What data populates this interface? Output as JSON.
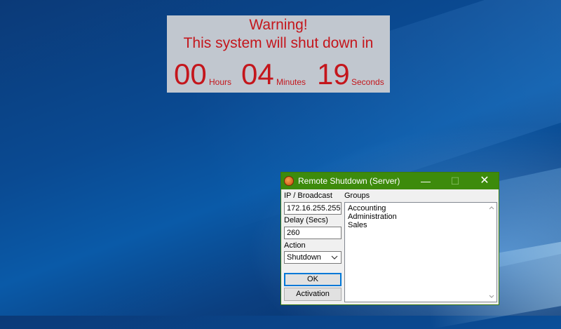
{
  "banner": {
    "line1": "Warning!",
    "line2": "This system will shut down in",
    "hours": "00",
    "hours_label": "Hours",
    "minutes": "04",
    "minutes_label": "Minutes",
    "seconds": "19",
    "seconds_label": "Seconds",
    "text_color": "#c4161c"
  },
  "window": {
    "title": "Remote Shutdown (Server)",
    "titlebar_color": "#3d8b0c",
    "minimize_glyph": "—",
    "maximize_glyph": "☐",
    "close_glyph": "✕",
    "ip_label": "IP / Broadcast",
    "ip_value": "172.16.255.255",
    "delay_label": "Delay (Secs)",
    "delay_value": "260",
    "action_label": "Action",
    "action_value": "Shutdown",
    "ok_label": "OK",
    "activation_label": "Activation",
    "groups_label": "Groups",
    "groups": [
      "Accounting",
      "Administration",
      "Sales"
    ]
  }
}
